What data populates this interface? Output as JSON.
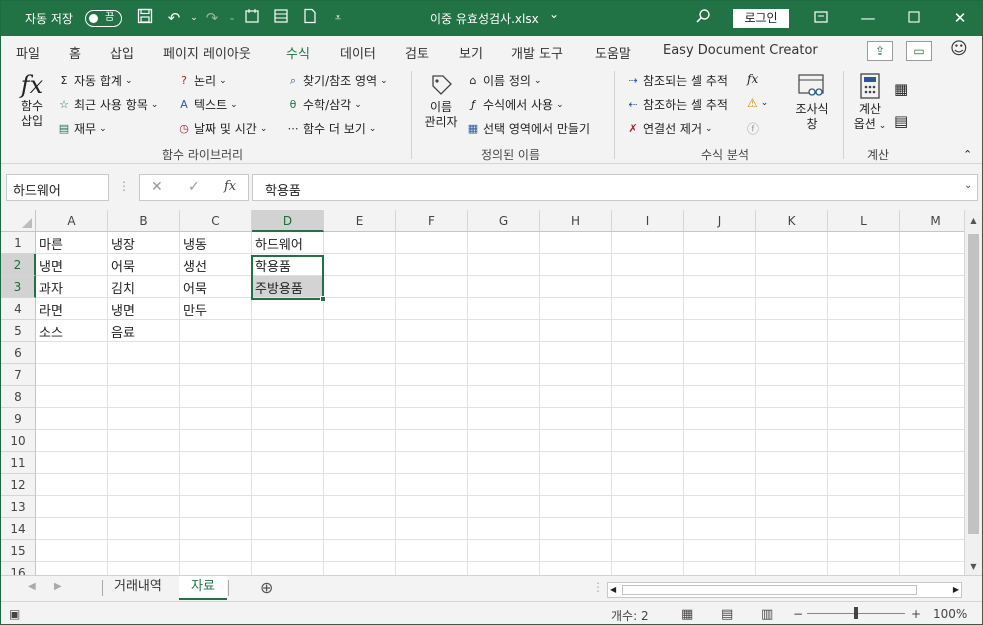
{
  "titlebar": {
    "autosave_label": "자동 저장",
    "autosave_state": "끔",
    "filename": "이중 유효성검사.xlsx",
    "filename_dropdown": "⌄",
    "login": "로그인",
    "accent_color": "#217346"
  },
  "tabs": [
    "파일",
    "홈",
    "삽입",
    "페이지 레이아웃",
    "수식",
    "데이터",
    "검토",
    "보기",
    "개발 도구",
    "도움말",
    "Easy Document Creator"
  ],
  "active_tab": "수식",
  "ribbon": {
    "function_library": {
      "insert_function": [
        "함수",
        "삽입"
      ],
      "items": [
        "자동 합계",
        "최근 사용 항목",
        "재무",
        "논리",
        "텍스트",
        "날짜 및 시간",
        "찾기/참조 영역",
        "수학/삼각",
        "함수 더 보기"
      ],
      "label": "함수 라이브러리"
    },
    "defined_names": {
      "name_manager": [
        "이름",
        "관리자"
      ],
      "items": [
        "이름 정의",
        "수식에서 사용",
        "선택 영역에서 만들기"
      ],
      "label": "정의된 이름"
    },
    "formula_auditing": {
      "items": [
        "참조되는 셀 추적",
        "참조하는 셀 추적",
        "연결선 제거"
      ],
      "watch_window": [
        "조사식",
        "창"
      ],
      "label": "수식 분석"
    },
    "calculation": {
      "options": [
        "계산",
        "옵션"
      ],
      "label": "계산"
    }
  },
  "formula_bar": {
    "name_box": "하드웨어",
    "formula": "학용품"
  },
  "grid": {
    "columns": [
      "A",
      "B",
      "C",
      "D",
      "E",
      "F",
      "G",
      "H",
      "I",
      "J",
      "K",
      "L",
      "M"
    ],
    "selected_column": "D",
    "rows": [
      "1",
      "2",
      "3",
      "4",
      "5",
      "6",
      "7",
      "8",
      "9",
      "10",
      "11",
      "12",
      "13",
      "14",
      "15",
      "16"
    ],
    "selected_rows": [
      "2",
      "3"
    ],
    "cells": [
      [
        "마른",
        "냉장",
        "냉동",
        "하드웨어"
      ],
      [
        "냉면",
        "어묵",
        "생선",
        "학용품"
      ],
      [
        "과자",
        "김치",
        "어묵",
        "주방용품"
      ],
      [
        "라면",
        "냉면",
        "만두",
        ""
      ],
      [
        "소스",
        "음료",
        "",
        ""
      ]
    ]
  },
  "sheets": [
    "거래내역",
    "자료"
  ],
  "active_sheet": "자료",
  "status": {
    "count": "개수: 2",
    "zoom": "100%"
  }
}
